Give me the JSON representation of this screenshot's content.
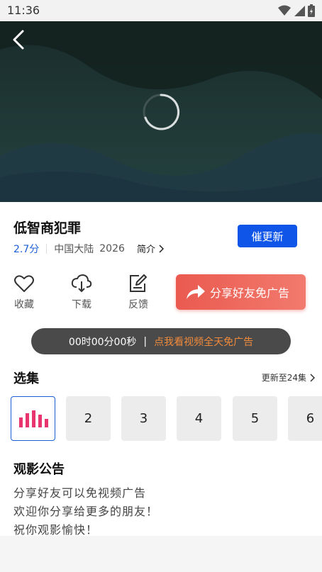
{
  "status": {
    "time": "11:36"
  },
  "video": {
    "title": "低智商犯罪",
    "score": "2.7分",
    "region": "中国大陆",
    "year": "2026",
    "intro_label": "简介"
  },
  "urge_button": "催更新",
  "actions": {
    "favorite": "收藏",
    "download": "下载",
    "feedback": "反馈"
  },
  "share_button": "分享好友免广告",
  "timer": {
    "time": "00时00分00秒",
    "separator": "|",
    "link": "点我看视频全天免广告"
  },
  "episodes": {
    "title": "选集",
    "update_info": "更新至24集",
    "items": [
      "",
      "2",
      "3",
      "4",
      "5",
      "6"
    ]
  },
  "notice": {
    "title": "观影公告",
    "lines": [
      "分享好友可以免视频广告",
      "欢迎你分享给更多的朋友！",
      "祝你观影愉快！"
    ]
  },
  "colors": {
    "accent": "#0f55e8",
    "share": "#ea5a4f",
    "link": "#f08a3c"
  }
}
